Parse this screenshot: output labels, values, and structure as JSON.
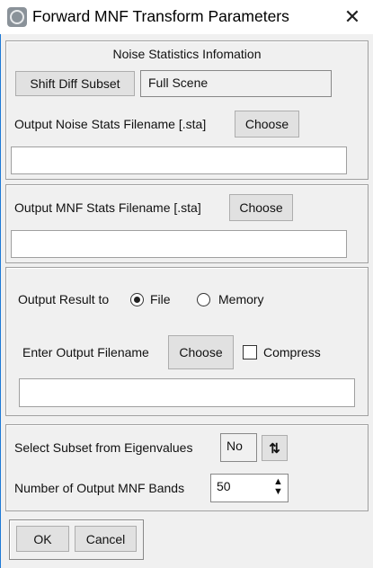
{
  "window": {
    "title": "Forward MNF Transform Parameters",
    "close_icon": "close-icon",
    "app_icon": "envi-app-icon"
  },
  "noise_panel": {
    "heading": "Noise Statistics Infomation",
    "shift_diff_subset_label": "Shift Diff Subset",
    "subset_value": "Full Scene",
    "output_noise_label": "Output Noise Stats Filename [.sta]",
    "choose_label": "Choose",
    "output_noise_value": ""
  },
  "mnf_stats_panel": {
    "label": "Output MNF Stats Filename [.sta]",
    "choose_label": "Choose",
    "value": ""
  },
  "output_panel": {
    "output_result_label": "Output Result to",
    "options": [
      {
        "label": "File",
        "selected": true
      },
      {
        "label": "Memory",
        "selected": false
      }
    ],
    "filename_label": "Enter Output Filename",
    "choose_label": "Choose",
    "compress_label": "Compress",
    "compress_checked": false,
    "filename_value": ""
  },
  "eigen_panel": {
    "subset_label": "Select Subset from Eigenvalues",
    "subset_value": "No",
    "toggle_icon": "swap-arrows-icon",
    "bands_label": "Number of Output MNF Bands",
    "bands_value": "50"
  },
  "footer": {
    "ok_label": "OK",
    "cancel_label": "Cancel"
  }
}
